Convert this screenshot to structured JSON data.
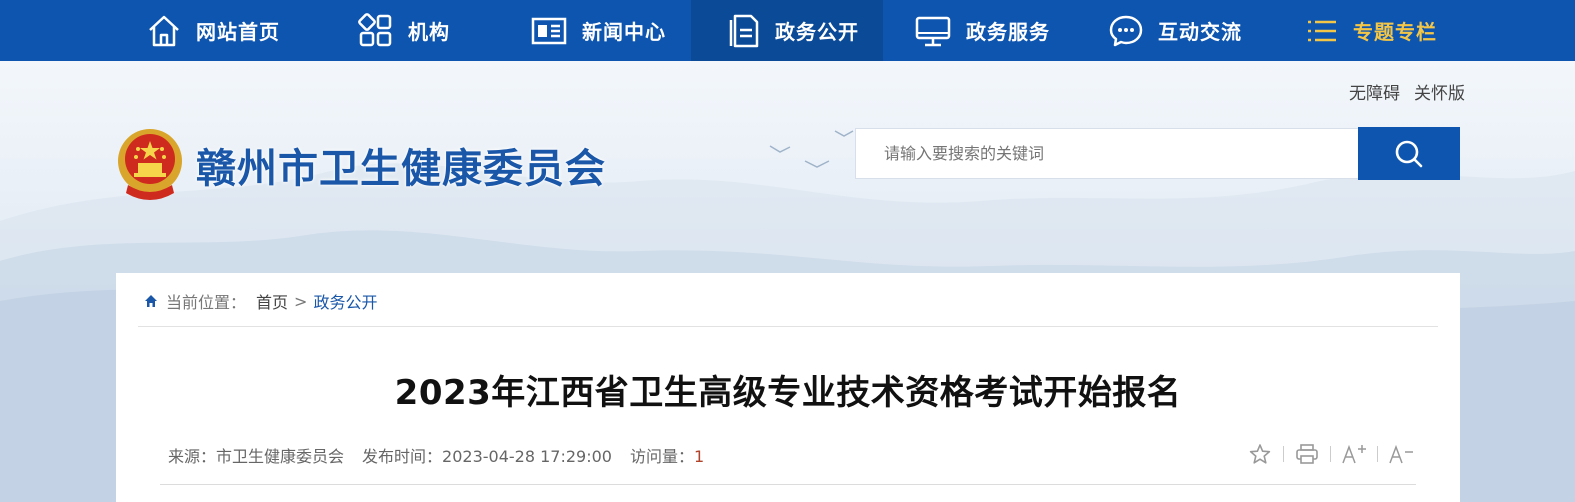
{
  "nav": {
    "items": [
      {
        "label": "网站首页",
        "icon": "home-icon",
        "active": false
      },
      {
        "label": "机构",
        "icon": "grid-icon",
        "active": false
      },
      {
        "label": "新闻中心",
        "icon": "news-icon",
        "active": false
      },
      {
        "label": "政务公开",
        "icon": "document-icon",
        "active": true
      },
      {
        "label": "政务服务",
        "icon": "monitor-icon",
        "active": false
      },
      {
        "label": "互动交流",
        "icon": "chat-icon",
        "active": false
      },
      {
        "label": "专题专栏",
        "icon": "list-icon",
        "active": false
      }
    ]
  },
  "header": {
    "util_links": [
      "无障碍",
      "关怀版"
    ],
    "site_title": "赣州市卫生健康委员会",
    "search_placeholder": "请输入要搜索的关键词"
  },
  "breadcrumb": {
    "prefix": "当前位置：",
    "home": "首页",
    "separator": ">",
    "current": "政务公开"
  },
  "article": {
    "title": "2023年江西省卫生高级专业技术资格考试开始报名",
    "source_label": "来源：",
    "source": "市卫生健康委员会",
    "date_label": "发布时间：",
    "date": "2023-04-28 17:29:00",
    "views_label": "访问量：",
    "views": "1"
  },
  "colors": {
    "nav_bg": "#0e55b0",
    "nav_active": "#0b4a97",
    "special": "#f3c647",
    "title_blue": "#1a57a9"
  }
}
